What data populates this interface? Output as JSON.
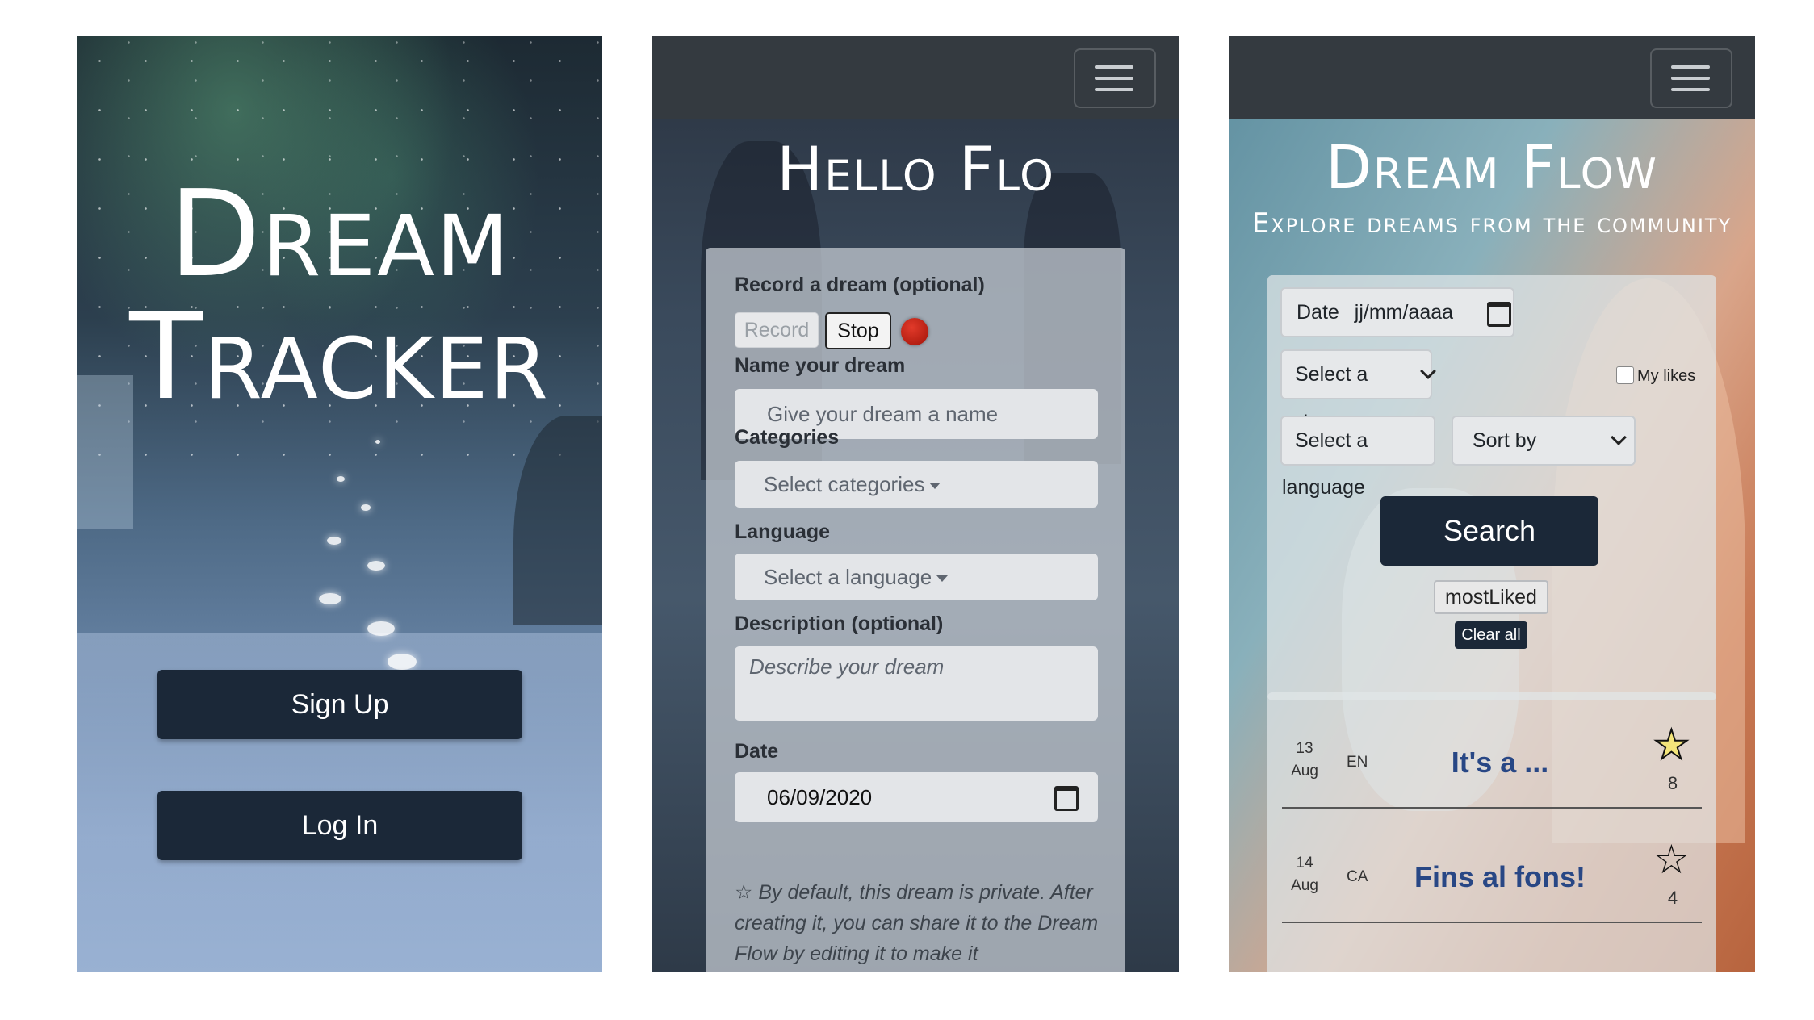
{
  "screen1": {
    "title_line1": "Dream",
    "title_line2": "Tracker",
    "signup_label": "Sign Up",
    "login_label": "Log In"
  },
  "screen2": {
    "menu_icon": "hamburger-icon",
    "heading": "Hello Flo",
    "record_label": "Record a dream (optional)",
    "record_button": "Record",
    "stop_button": "Stop",
    "name_label": "Name your dream",
    "name_placeholder": "Give your dream a name",
    "categories_label": "Categories",
    "categories_select": "Select categories",
    "language_label": "Language",
    "language_select": "Select a language",
    "description_label": "Description (optional)",
    "description_placeholder": "Describe your dream",
    "date_label": "Date",
    "date_value": "06/09/2020",
    "privacy_note": "By default, this dream is private. After creating it, you can share it to the Dream Flow by editing it to make it"
  },
  "screen3": {
    "menu_icon": "hamburger-icon",
    "heading": "Dream Flow",
    "subheading": "Explore dreams from the community",
    "date_label": "Date",
    "date_placeholder": "jj/mm/aaaa",
    "category_select": "Select a category",
    "mylikes_label": "My likes",
    "language_select": "Select a language",
    "sort_select": "Sort by",
    "search_button": "Search",
    "active_filter": "mostLiked",
    "clear_all": "Clear all",
    "dreams": [
      {
        "day": "13",
        "month": "Aug",
        "lang": "EN",
        "title": "It's a ...",
        "likes": "8",
        "liked": true
      },
      {
        "day": "14",
        "month": "Aug",
        "lang": "CA",
        "title": "Fins al fons!",
        "likes": "4",
        "liked": false
      }
    ]
  },
  "colors": {
    "button_dark": "#1b2838",
    "navbar": "#343a40",
    "record_dot": "#c0190c",
    "dream_title": "#284785"
  }
}
